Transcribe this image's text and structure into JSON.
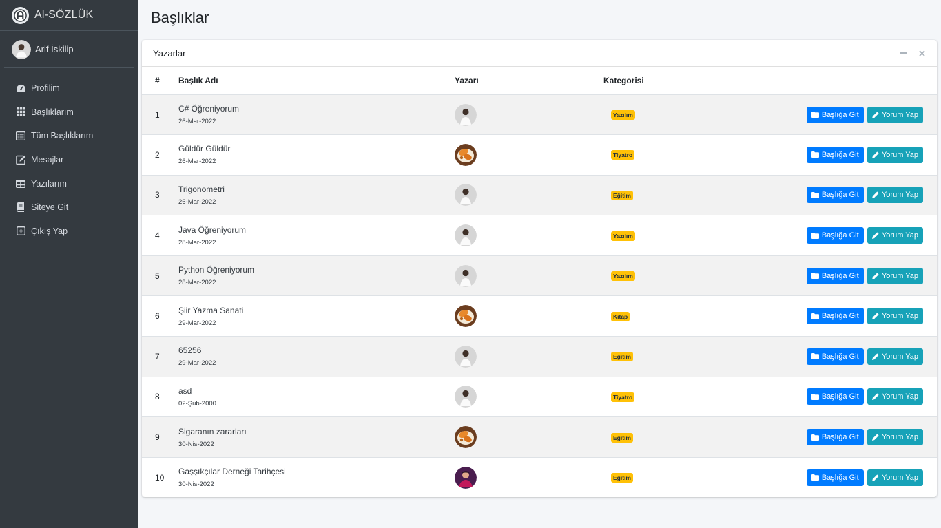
{
  "brand": {
    "name": "Al-SÖZLÜK",
    "logo_icon": "brand-logo-icon"
  },
  "user": {
    "name": "Arif İskilip"
  },
  "nav": [
    {
      "label": "Profilim",
      "icon": "dashboard-icon"
    },
    {
      "label": "Başlıklarım",
      "icon": "grid-icon"
    },
    {
      "label": "Tüm Başlıklarım",
      "icon": "list-icon"
    },
    {
      "label": "Mesajlar",
      "icon": "edit-icon"
    },
    {
      "label": "Yazılarım",
      "icon": "table-icon"
    },
    {
      "label": "Siteye Git",
      "icon": "book-icon"
    },
    {
      "label": "Çıkış Yap",
      "icon": "plus-square-icon"
    }
  ],
  "page": {
    "title": "Başlıklar"
  },
  "card": {
    "title": "Yazarlar",
    "headers": {
      "num": "#",
      "title": "Başlık Adı",
      "author": "Yazarı",
      "category": "Kategorisi"
    },
    "buttons": {
      "go": "Başlığa Git",
      "comment": "Yorum Yap"
    }
  },
  "rows": [
    {
      "num": "1",
      "title": "C# Öğreniyorum",
      "date": "26-Mar-2022",
      "category": "Yazılım",
      "avatar": "person"
    },
    {
      "num": "2",
      "title": "Güldür Güldür",
      "date": "26-Mar-2022",
      "category": "Tiyatro",
      "avatar": "food"
    },
    {
      "num": "3",
      "title": "Trigonometri",
      "date": "26-Mar-2022",
      "category": "Eğitim",
      "avatar": "person"
    },
    {
      "num": "4",
      "title": "Java Öğreniyorum",
      "date": "28-Mar-2022",
      "category": "Yazılım",
      "avatar": "person"
    },
    {
      "num": "5",
      "title": "Python Öğreniyorum",
      "date": "28-Mar-2022",
      "category": "Yazılım",
      "avatar": "person"
    },
    {
      "num": "6",
      "title": "Şiir Yazma Sanati",
      "date": "29-Mar-2022",
      "category": "Kitap",
      "avatar": "food"
    },
    {
      "num": "7",
      "title": "65256",
      "date": "29-Mar-2022",
      "category": "Eğitim",
      "avatar": "person"
    },
    {
      "num": "8",
      "title": "asd",
      "date": "02-Şub-2000",
      "category": "Tiyatro",
      "avatar": "person"
    },
    {
      "num": "9",
      "title": "Sigaranın zararları",
      "date": "30-Nis-2022",
      "category": "Eğitim",
      "avatar": "food"
    },
    {
      "num": "10",
      "title": "Gaşşıkçılar Derneği Tarihçesi",
      "date": "30-Nis-2022",
      "category": "Eğitim",
      "avatar": "purple"
    }
  ],
  "colors": {
    "sidebar": "#343a40",
    "primary": "#007bff",
    "info": "#17a2b8",
    "warning": "#ffc107"
  }
}
